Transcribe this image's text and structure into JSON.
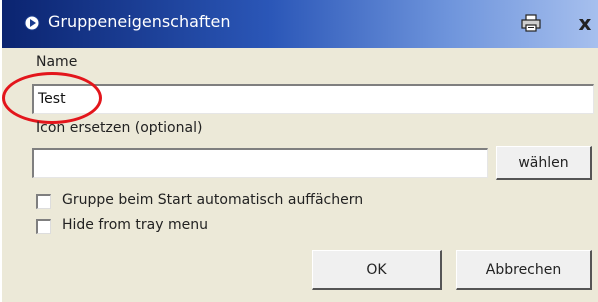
{
  "window": {
    "title": "Gruppeneigenschaften",
    "close_glyph": "x"
  },
  "name_section": {
    "label": "Name",
    "value": "Test"
  },
  "icon_section": {
    "label": "Icon ersetzen (optional)",
    "value": "",
    "choose_button": "wählen"
  },
  "options": [
    {
      "label": "Gruppe beim Start automatisch auffächern",
      "checked": false
    },
    {
      "label": "Hide from tray menu",
      "checked": false
    }
  ],
  "buttons": {
    "ok": "OK",
    "cancel": "Abbrechen"
  },
  "colors": {
    "highlight": "#e3161c",
    "titlebar_dark": "#0b2470"
  }
}
